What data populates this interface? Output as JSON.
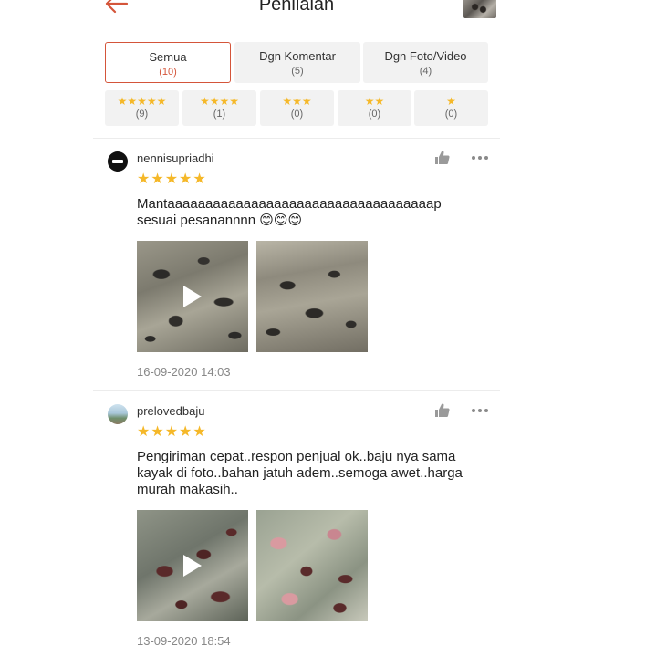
{
  "header": {
    "title": "Penilaian",
    "back_icon": "arrow-left-icon",
    "accent": "#d4553a"
  },
  "filters": {
    "tabs": [
      {
        "label": "Semua",
        "count": "(10)",
        "active": true
      },
      {
        "label": "Dgn Komentar",
        "count": "(5)",
        "active": false
      },
      {
        "label": "Dgn Foto/Video",
        "count": "(4)",
        "active": false
      }
    ],
    "stars": [
      {
        "stars": "★★★★★",
        "count": "(9)"
      },
      {
        "stars": "★★★★",
        "count": "(1)"
      },
      {
        "stars": "★★★",
        "count": "(0)"
      },
      {
        "stars": "★★",
        "count": "(0)"
      },
      {
        "stars": "★",
        "count": "(0)"
      }
    ],
    "star_color": "#f5b829"
  },
  "reviews": [
    {
      "username": "nennisupriadhi",
      "rating": "★★★★★",
      "text": "Mantaaaaaaaaaaaaaaaaaaaaaaaaaaaaaaaaaaap sesuai pesanannnn 😊😊😊",
      "media": [
        "video",
        "photo"
      ],
      "timestamp": "16-09-2020 14:03"
    },
    {
      "username": "prelovedbaju",
      "rating": "★★★★★",
      "text": "Pengiriman cepat..respon penjual ok..baju nya sama kayak di foto..bahan jatuh adem..semoga awet..harga murah makasih..",
      "media": [
        "video",
        "photo"
      ],
      "timestamp": "13-09-2020 18:54"
    }
  ]
}
